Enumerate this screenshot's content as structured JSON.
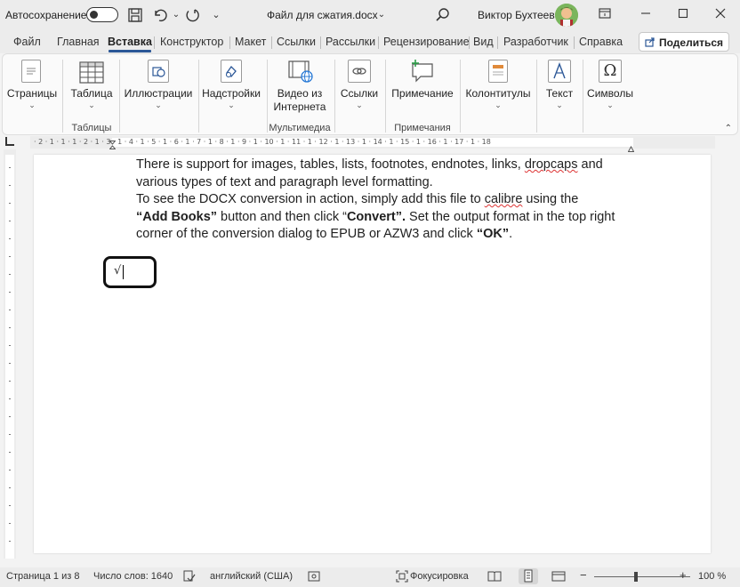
{
  "titlebar": {
    "autosave_label": "Автосохранение",
    "doc_title": "Файл для сжатия.docx",
    "doc_title_caret": "⌄",
    "user_name": "Виктор Бухтеев"
  },
  "tabs": [
    {
      "label": "Файл"
    },
    {
      "label": "Главная"
    },
    {
      "label": "Вставка",
      "active": true
    },
    {
      "label": "Конструктор"
    },
    {
      "label": "Макет"
    },
    {
      "label": "Ссылки"
    },
    {
      "label": "Рассылки"
    },
    {
      "label": "Рецензирование"
    },
    {
      "label": "Вид"
    },
    {
      "label": "Разработчик"
    },
    {
      "label": "Справка"
    }
  ],
  "share_label": "Поделиться",
  "ribbon": {
    "buttons": [
      {
        "label": "Страницы",
        "icon": "pages-icon"
      },
      {
        "label": "Таблица",
        "icon": "table-icon"
      },
      {
        "label": "Иллюстрации",
        "icon": "illustrations-icon"
      },
      {
        "label": "Надстройки",
        "icon": "addins-icon"
      },
      {
        "label": "Видео из Интернета",
        "line1": "Видео из",
        "line2": "Интернета",
        "icon": "video-icon"
      },
      {
        "label": "Ссылки",
        "icon": "links-icon"
      },
      {
        "label": "Примечание",
        "icon": "comment-icon"
      },
      {
        "label": "Колонтитулы",
        "icon": "header-footer-icon"
      },
      {
        "label": "Текст",
        "icon": "text-icon"
      },
      {
        "label": "Символы",
        "icon": "symbols-icon"
      }
    ],
    "groups": [
      "Таблицы",
      "Мультимедиа",
      "Примечания"
    ]
  },
  "ruler": {
    "numbers": "· 2 · 1 · 1 · 1 · 2 · 1 · 3 · 1 · 4 · 1 · 5 · 1 · 6 · 1 · 7 · 1 · 8 · 1 · 9 · 1 · 10 · 1 · 11 · 1 · 12 · 1 · 13 · 1 · 14 · 1 · 15 · 1 · 16 · 1 · 17 · 1 · 18"
  },
  "document": {
    "p1_a": "There is support for images, tables, lists, footnotes, endnotes, links, ",
    "p1_wave": "dropcaps",
    "p1_b": " and various types of text and paragraph level formatting.",
    "p2_a": "To see the DOCX conversion in action, simply add this file to ",
    "p2_wave": "calibre",
    "p2_b": " using the ",
    "p2_bold1": "“Add Books”",
    "p2_c": " button and then click “",
    "p2_bold2": "Convert”.",
    "p2_d": "  Set the output format in the top right corner of the conversion dialog to EPUB or AZW3 and click ",
    "p2_bold3": "“OK”",
    "p2_e": ".",
    "equation_symbol": "√"
  },
  "statusbar": {
    "page": "Страница 1 из 8",
    "words": "Число слов: 1640",
    "language": "английский (США)",
    "focus": "Фокусировка",
    "zoom": "100 %",
    "zoom_minus": "−",
    "zoom_plus": "+"
  }
}
